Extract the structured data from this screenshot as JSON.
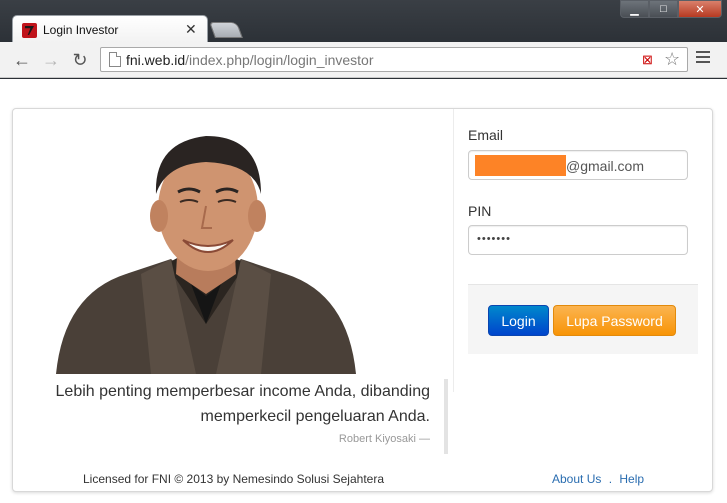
{
  "browser": {
    "tab": {
      "title": "Login Investor"
    },
    "url": {
      "host": "fni.web.id",
      "path": "/index.php/login/login_investor"
    }
  },
  "hero": {
    "quote": "Lebih penting memperbesar income Anda, dibanding memperkecil pengeluaran Anda.",
    "author": "Robert Kiyosaki —"
  },
  "form": {
    "email_label": "Email",
    "email_value_suffix": "@gmail.com",
    "pin_label": "PIN",
    "pin_value": "•••••••",
    "login_button": "Login",
    "forgot_button": "Lupa Password"
  },
  "footer": {
    "license": "Licensed for FNI © 2013 by Nemesindo Solusi Sejahtera",
    "about_link": "About Us",
    "separator": ".",
    "help_link": "Help"
  },
  "colors": {
    "login_button": "#0055cc",
    "forgot_button": "#f89406",
    "redaction": "#fd8326",
    "link": "#2a6db0"
  }
}
